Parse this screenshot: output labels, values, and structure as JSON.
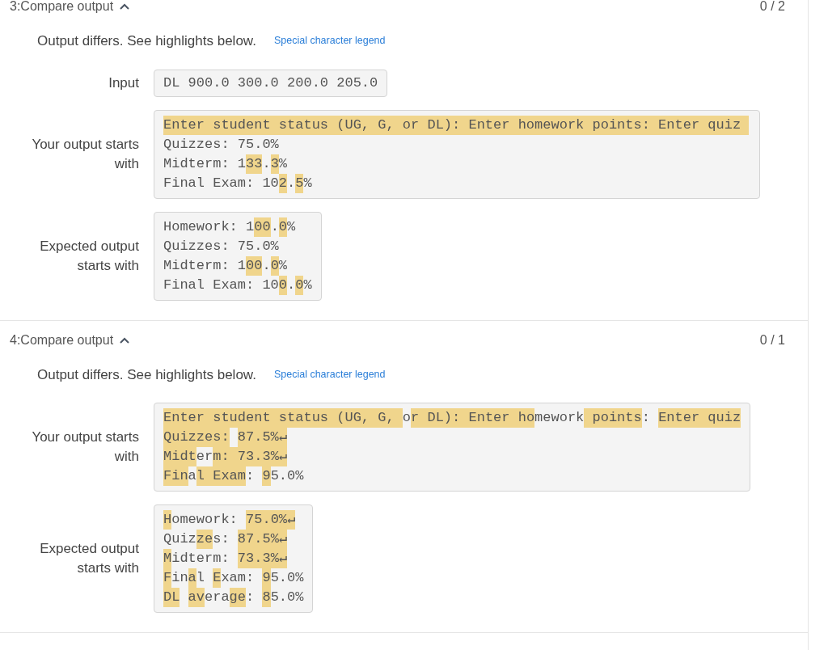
{
  "tests": [
    {
      "title": "3:Compare output",
      "expanded": true,
      "score": "0 / 2",
      "message": "Output differs. See highlights below.",
      "legend_link": "Special character legend",
      "rows": [
        {
          "kind": "plain",
          "label": "Input",
          "lines": [
            [
              {
                "text": "DL 900.0 300.0 200.0 205.0",
                "highlighted": false
              }
            ]
          ]
        },
        {
          "kind": "diff",
          "label": "Your output starts with",
          "lines": [
            [
              {
                "text": "Enter student status (UG, G, or DL): Enter homework points: Enter quiz ",
                "highlighted": true
              }
            ],
            [
              {
                "text": "Quizzes: 75.0%",
                "highlighted": false
              }
            ],
            [
              {
                "text": "Midterm: 1",
                "highlighted": false
              },
              {
                "text": "33",
                "highlighted": true
              },
              {
                "text": ".",
                "highlighted": false
              },
              {
                "text": "3",
                "highlighted": true
              },
              {
                "text": "%",
                "highlighted": false
              }
            ],
            [
              {
                "text": "Final Exam: 10",
                "highlighted": false
              },
              {
                "text": "2",
                "highlighted": true
              },
              {
                "text": ".",
                "highlighted": false
              },
              {
                "text": "5",
                "highlighted": true
              },
              {
                "text": "%",
                "highlighted": false
              }
            ]
          ]
        },
        {
          "kind": "diff",
          "label": "Expected output starts with",
          "lines": [
            [
              {
                "text": "Homework: 1",
                "highlighted": false
              },
              {
                "text": "00",
                "highlighted": true
              },
              {
                "text": ".",
                "highlighted": false
              },
              {
                "text": "0",
                "highlighted": true
              },
              {
                "text": "%",
                "highlighted": false
              }
            ],
            [
              {
                "text": "Quizzes: 75.0%",
                "highlighted": false
              }
            ],
            [
              {
                "text": "Midterm: 1",
                "highlighted": false
              },
              {
                "text": "00",
                "highlighted": true
              },
              {
                "text": ".",
                "highlighted": false
              },
              {
                "text": "0",
                "highlighted": true
              },
              {
                "text": "%",
                "highlighted": false
              }
            ],
            [
              {
                "text": "Final Exam: 10",
                "highlighted": false
              },
              {
                "text": "0",
                "highlighted": true
              },
              {
                "text": ".",
                "highlighted": false
              },
              {
                "text": "0",
                "highlighted": true
              },
              {
                "text": "%",
                "highlighted": false
              }
            ]
          ]
        }
      ]
    },
    {
      "title": "4:Compare output",
      "expanded": true,
      "score": "0 / 1",
      "message": "Output differs. See highlights below.",
      "legend_link": "Special character legend",
      "rows": [
        {
          "kind": "diff",
          "label": "Your output starts with",
          "lines": [
            [
              {
                "text": "Enter student status (UG, G, ",
                "highlighted": true
              },
              {
                "text": "o",
                "highlighted": false
              },
              {
                "text": "r DL): Enter ho",
                "highlighted": true
              },
              {
                "text": "mework",
                "highlighted": false
              },
              {
                "text": " points",
                "highlighted": true
              },
              {
                "text": ": ",
                "highlighted": false
              },
              {
                "text": "Enter quiz",
                "highlighted": true
              }
            ],
            [
              {
                "text": "Quizzes:",
                "highlighted": true
              },
              {
                "space": true,
                "highlighted": false
              },
              {
                "text": "87.5%↵",
                "highlighted": true
              }
            ],
            [
              {
                "text": "Midt",
                "highlighted": true
              },
              {
                "text": "er",
                "highlighted": false
              },
              {
                "text": "m: 73.3%↵",
                "highlighted": true
              }
            ],
            [
              {
                "text": "Fin",
                "highlighted": true
              },
              {
                "text": "a",
                "highlighted": false
              },
              {
                "text": "l Exam",
                "highlighted": true
              },
              {
                "text": ": ",
                "highlighted": false
              },
              {
                "text": "9",
                "highlighted": true
              },
              {
                "text": "5.0%",
                "highlighted": false
              }
            ]
          ]
        },
        {
          "kind": "diff",
          "label": "Expected output starts with",
          "lines": [
            [
              {
                "text": "H",
                "highlighted": true
              },
              {
                "text": "omework: ",
                "highlighted": false
              },
              {
                "text": "75.0%↵",
                "highlighted": true
              }
            ],
            [
              {
                "text": "Quiz",
                "highlighted": false
              },
              {
                "text": "ze",
                "highlighted": true
              },
              {
                "text": "s: ",
                "highlighted": false
              },
              {
                "text": "87.5%↵",
                "highlighted": true
              }
            ],
            [
              {
                "text": "M",
                "highlighted": true
              },
              {
                "text": "idterm: ",
                "highlighted": false
              },
              {
                "text": "73.3%↵",
                "highlighted": true
              }
            ],
            [
              {
                "text": "F",
                "highlighted": true
              },
              {
                "text": "in",
                "highlighted": false
              },
              {
                "text": "a",
                "highlighted": true
              },
              {
                "text": "l ",
                "highlighted": false
              },
              {
                "text": "E",
                "highlighted": true
              },
              {
                "text": "xam: ",
                "highlighted": false
              },
              {
                "text": "9",
                "highlighted": true
              },
              {
                "text": "5.0%",
                "highlighted": false
              }
            ],
            [
              {
                "text": "DL",
                "highlighted": true
              },
              {
                "space": true,
                "highlighted": false
              },
              {
                "text": "av",
                "highlighted": true
              },
              {
                "text": "era",
                "highlighted": false
              },
              {
                "text": "ge",
                "highlighted": true
              },
              {
                "text": ": ",
                "highlighted": false
              },
              {
                "text": "8",
                "highlighted": true
              },
              {
                "text": "5.0%",
                "highlighted": false
              }
            ]
          ]
        }
      ]
    }
  ]
}
